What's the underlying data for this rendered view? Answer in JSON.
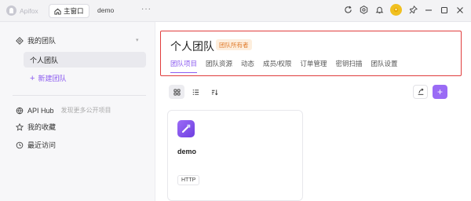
{
  "app": {
    "name": "Apifox"
  },
  "titlebar": {
    "tabs": [
      {
        "label": "主窗口",
        "icon": "home-icon"
      },
      {
        "label": "demo"
      }
    ],
    "more_label": "···",
    "icons": [
      "refresh-icon",
      "settings-icon",
      "bell-icon",
      "avatar",
      "pin-icon",
      "minimize-icon",
      "maximize-icon",
      "close-icon"
    ]
  },
  "sidebar": {
    "team_header": "我的团队",
    "team_item": "个人团队",
    "new_team": "新建团队",
    "api_hub": {
      "label": "API Hub",
      "sub": "发现更多公开项目"
    },
    "favorites": "我的收藏",
    "recent": "最近访问"
  },
  "team": {
    "title": "个人团队",
    "badge": "团队所有者",
    "tabs": [
      "团队项目",
      "团队资源",
      "动态",
      "成员/权限",
      "订单管理",
      "密钥扫描",
      "团队设置"
    ],
    "active_tab": "团队项目"
  },
  "project": {
    "name": "demo",
    "type": "HTTP"
  },
  "colors": {
    "accent": "#8c5cf0",
    "badge_bg": "#fdeedd",
    "badge_text": "#e07a2a",
    "highlight_border": "#e03d3d"
  }
}
